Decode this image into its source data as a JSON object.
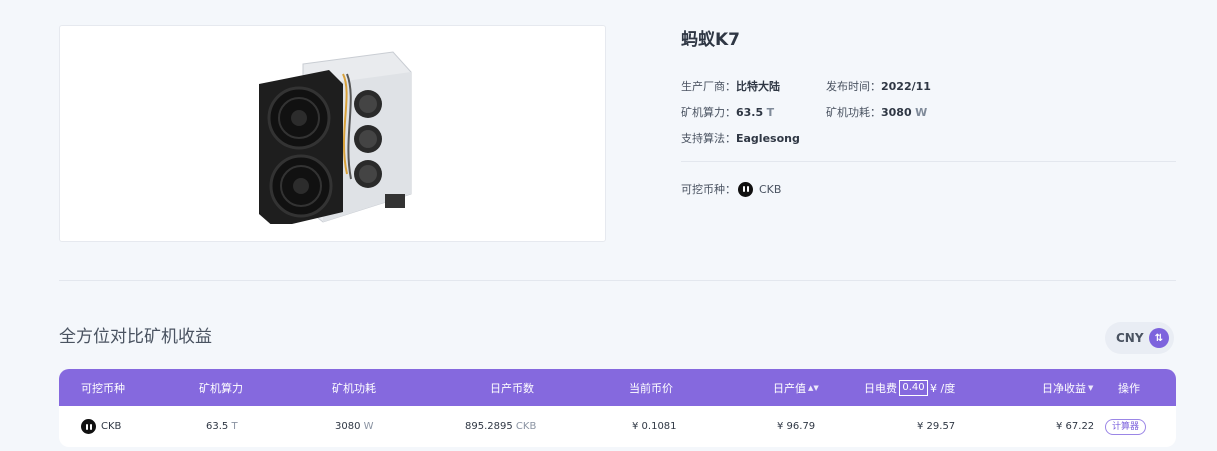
{
  "product": {
    "title": "蚂蚁K7",
    "manufacturer_label": "生产厂商：",
    "manufacturer": "比特大陆",
    "release_label": "发布时间：",
    "release": "2022/11",
    "hashrate_label": "矿机算力：",
    "hashrate": "63.5",
    "hashrate_unit": "T",
    "power_label": "矿机功耗：",
    "power": "3080",
    "power_unit": "W",
    "algo_label": "支持算法：",
    "algo": "Eaglesong",
    "coins_label": "可挖币种：",
    "coin": "CKB"
  },
  "section": {
    "title": "全方位对比矿机收益",
    "currency": "CNY",
    "currency_icon": "swap-icon"
  },
  "table": {
    "headers": {
      "coin": "可挖币种",
      "hashrate": "矿机算力",
      "power": "矿机功耗",
      "daily_coins": "日产币数",
      "price": "当前币价",
      "daily_value": "日产值",
      "elec_prefix": "日电费",
      "elec_value": "0.40",
      "elec_suffix": "¥ /度",
      "net": "日净收益",
      "action": "操作"
    },
    "row": {
      "coin": "CKB",
      "hashrate": "63.5",
      "hashrate_unit": "T",
      "power": "3080",
      "power_unit": "W",
      "daily_coins": "895.2895",
      "daily_coins_unit": "CKB",
      "price": "¥ 0.1081",
      "daily_value": "¥ 96.79",
      "elec_cost": "¥ 29.57",
      "net": "¥ 67.22",
      "action": "计算器"
    }
  },
  "colors": {
    "accent": "#8569de",
    "background": "#f4f7fb"
  }
}
